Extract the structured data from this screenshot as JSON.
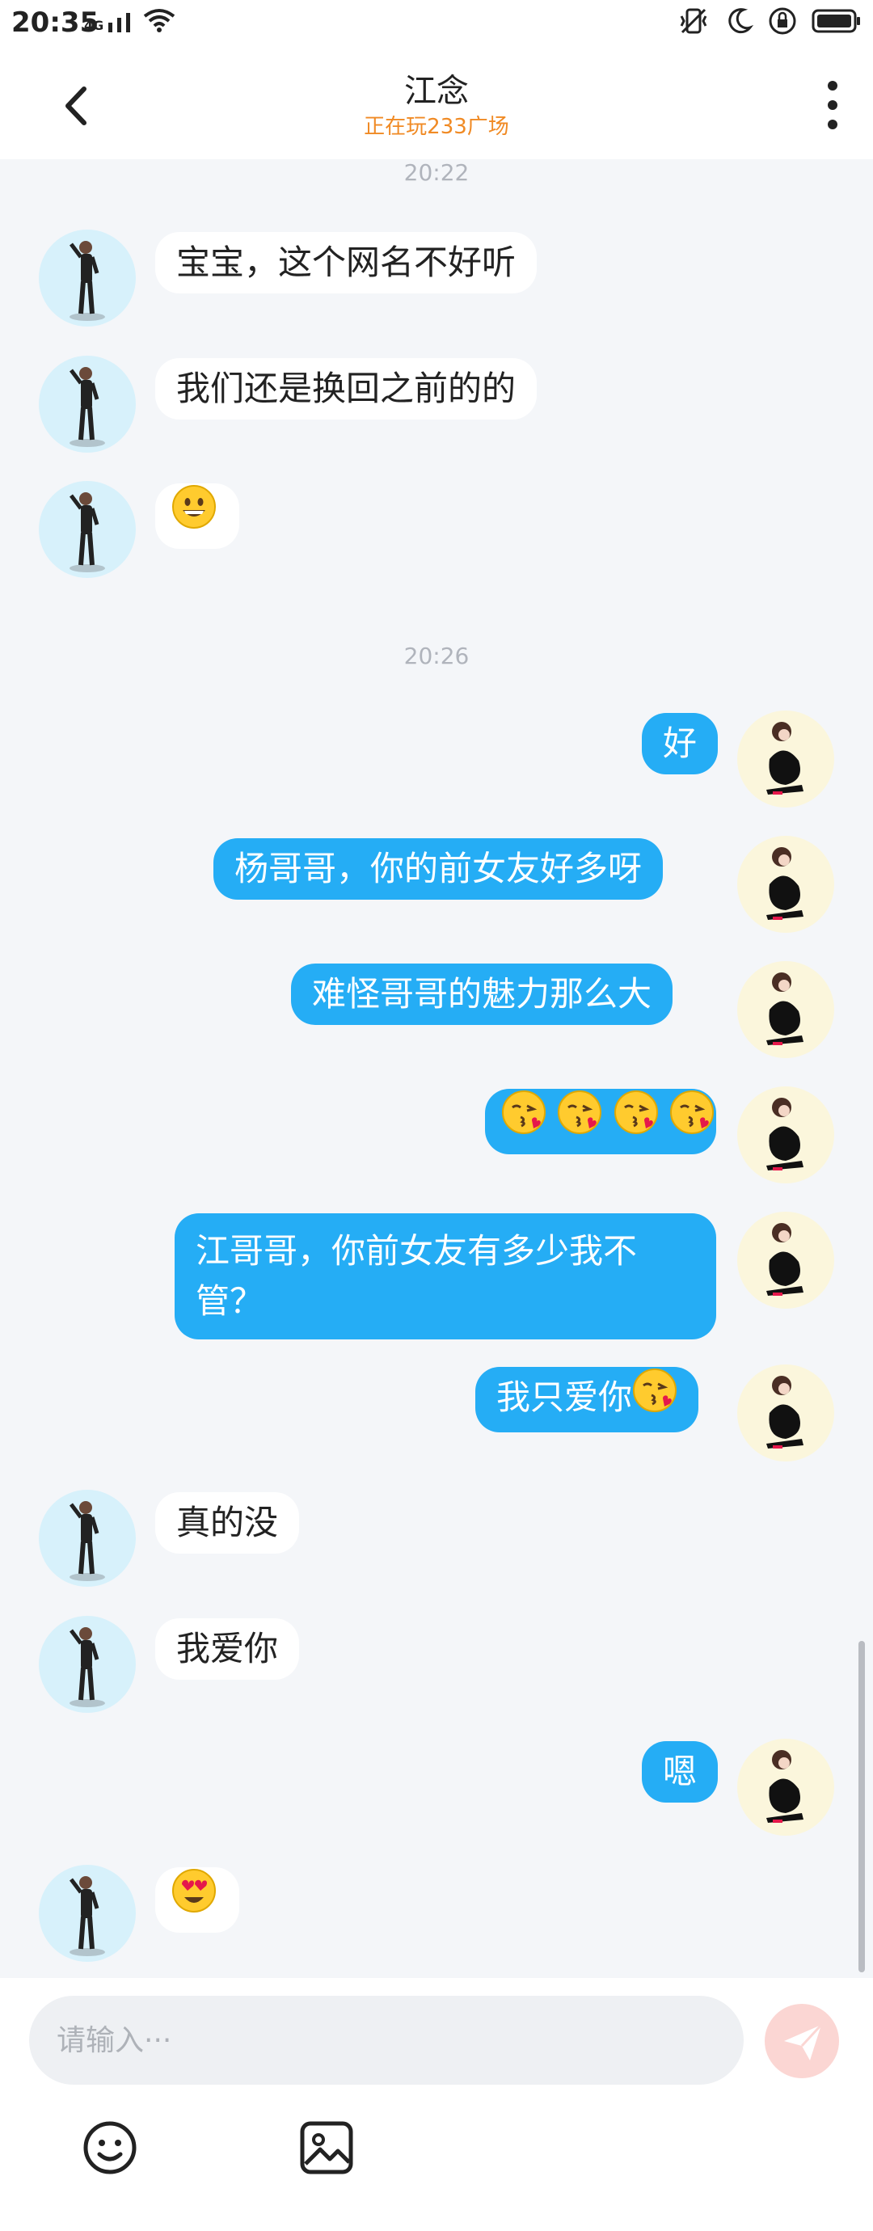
{
  "status_bar": {
    "time": "20:35",
    "network": "4G"
  },
  "header": {
    "title": "江念",
    "subtitle": "正在玩233广场"
  },
  "messages": [
    {
      "type": "time",
      "text": "20:22"
    },
    {
      "type": "msg",
      "side": "in",
      "text": "宝宝，这个网名不好听"
    },
    {
      "type": "msg",
      "side": "in",
      "text": "我们还是换回之前的的"
    },
    {
      "type": "msg",
      "side": "in",
      "emoji": [
        "grin"
      ]
    },
    {
      "type": "time",
      "text": "20:26"
    },
    {
      "type": "msg",
      "side": "out",
      "text": "好"
    },
    {
      "type": "msg",
      "side": "out",
      "text": "杨哥哥，你的前女友好多呀"
    },
    {
      "type": "msg",
      "side": "out",
      "text": "难怪哥哥的魅力那么大"
    },
    {
      "type": "msg",
      "side": "out",
      "emoji": [
        "kiss",
        "kiss",
        "kiss",
        "kiss"
      ]
    },
    {
      "type": "msg",
      "side": "out",
      "text": "江哥哥，你前女友有多少我不管？"
    },
    {
      "type": "msg",
      "side": "out",
      "text": "我只爱你",
      "emoji": [
        "kiss"
      ]
    },
    {
      "type": "msg",
      "side": "in",
      "text": "真的没"
    },
    {
      "type": "msg",
      "side": "in",
      "text": "我爱你"
    },
    {
      "type": "msg",
      "side": "out",
      "text": "嗯"
    },
    {
      "type": "msg",
      "side": "in",
      "emoji": [
        "heart-eyes"
      ]
    }
  ],
  "composer": {
    "placeholder": "请输入···"
  },
  "colors": {
    "outgoing_bubble": "#25adf5",
    "incoming_bubble": "#ffffff",
    "background": "#f4f6f9",
    "subtitle": "#f08a24"
  },
  "icons": {
    "back": "chevron-left-icon",
    "more": "more-vertical-icon",
    "send": "send-icon",
    "emoji_tool": "smiley-icon",
    "image_tool": "image-icon"
  }
}
